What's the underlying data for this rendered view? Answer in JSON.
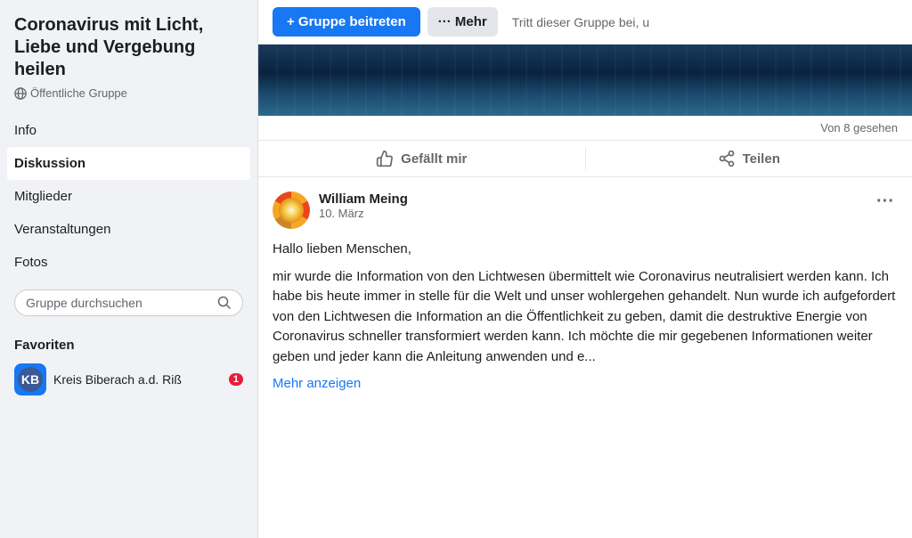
{
  "sidebar": {
    "title": "Coronavirus mit Licht, Liebe und Vergebung heilen",
    "subtitle": "Öffentliche Gruppe",
    "nav": [
      {
        "id": "info",
        "label": "Info",
        "active": false
      },
      {
        "id": "diskussion",
        "label": "Diskussion",
        "active": true
      },
      {
        "id": "mitglieder",
        "label": "Mitglieder",
        "active": false
      },
      {
        "id": "veranstaltungen",
        "label": "Veranstaltungen",
        "active": false
      },
      {
        "id": "fotos",
        "label": "Fotos",
        "active": false
      }
    ],
    "search_placeholder": "Gruppe durchsuchen",
    "favorites_label": "Favoriten",
    "favorites": [
      {
        "id": "kreis-biberach",
        "name": "Kreis Biberach a.d. Riß",
        "badge": "1"
      }
    ]
  },
  "header": {
    "join_label": "+ Gruppe beitreten",
    "more_label": "··· Mehr",
    "hint_text": "Tritt dieser Gruppe bei, u"
  },
  "content": {
    "seen_text": "Von 8 gesehen",
    "like_label": "Gefällt mir",
    "share_label": "Teilen"
  },
  "post": {
    "author": "William Meing",
    "date": "10. März",
    "more_dots": "···",
    "greeting": "Hallo lieben Menschen,",
    "body": "mir wurde die Information von den Lichtwesen übermittelt wie Coronavirus neutralisiert werden kann. Ich habe bis heute immer in stelle für die Welt und unser wohlergehen gehandelt. Nun wurde ich aufgefordert von den Lichtwesen die Information an die Öffentlichkeit zu geben, damit die destruktive Energie von Coronavirus schneller transformiert werden kann. Ich möchte die mir gegebenen Informationen weiter geben und jeder kann die Anleitung anwenden und e...",
    "more_label": "Mehr anzeigen"
  }
}
